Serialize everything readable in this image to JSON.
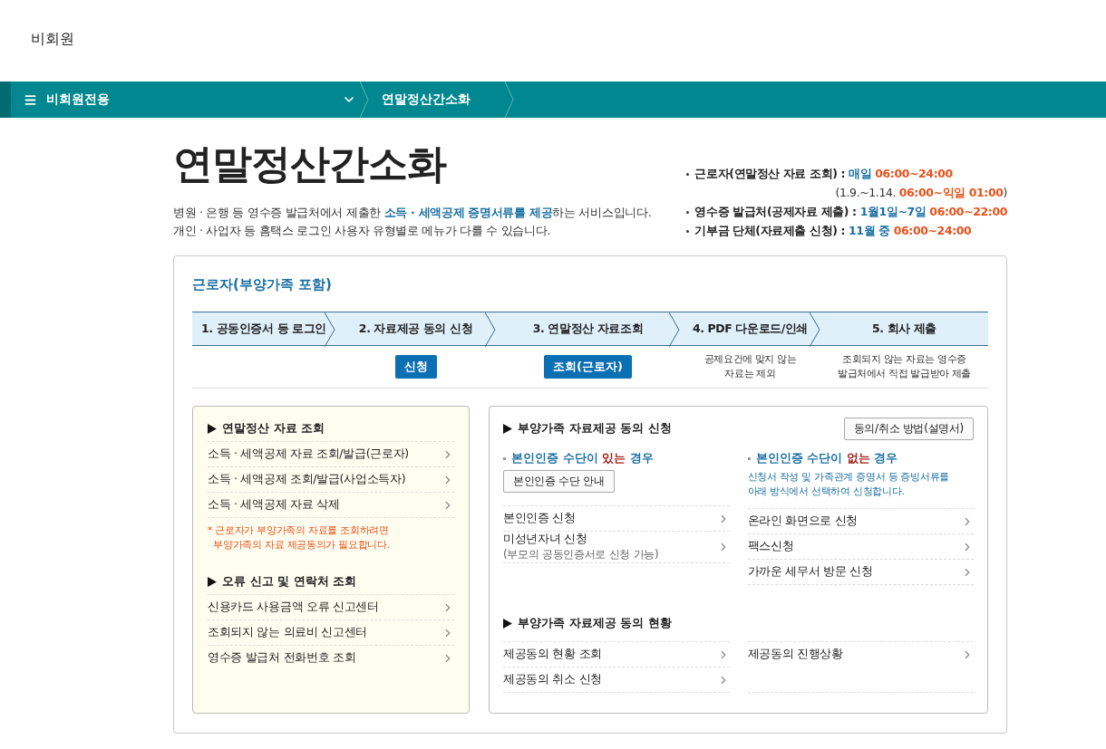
{
  "header": {
    "user_label": "비회원"
  },
  "nav": {
    "items": [
      {
        "label": "비회원전용",
        "kind": "dropdown"
      },
      {
        "label": "연말정산간소화",
        "kind": "page"
      }
    ]
  },
  "intro": {
    "title": "연말정산간소화",
    "description": [
      [
        {
          "text": "병원 · 은행 등 영수증 발급처에서 제출한 ",
          "color": "#333333",
          "bold": false
        },
        {
          "text": "소득 · 세액공제 증명서류를 제공",
          "color": "#1a6fa3",
          "bold": true
        },
        {
          "text": "하는 서비스입니다.",
          "color": "#333333",
          "bold": false
        }
      ],
      [
        {
          "text": "개인 · 사업자 등 홈택스 로그인 사용자 유형별로 메뉴가 다를 수 있습니다.",
          "color": "#333333",
          "bold": false
        }
      ]
    ],
    "schedule": [
      {
        "bullet": true,
        "segments": [
          {
            "text": "근로자(연말정산 자료 조회) : ",
            "color": "#222222",
            "bold": true
          },
          {
            "text": "매일 ",
            "color": "#1a6fa3",
            "bold": true
          },
          {
            "text": "06:00~24:00",
            "color": "#e8521a",
            "bold": true
          }
        ]
      },
      {
        "bullet": false,
        "segments": [
          {
            "text": "(1.9.~1.14. ",
            "color": "#333333",
            "bold": false
          },
          {
            "text": "06:00~익일 01:00",
            "color": "#e8521a",
            "bold": true
          },
          {
            "text": ")",
            "color": "#333333",
            "bold": false
          }
        ]
      },
      {
        "bullet": true,
        "segments": [
          {
            "text": "영수증 발급처(공제자료 제출) : ",
            "color": "#222222",
            "bold": true
          },
          {
            "text": "1월1일~7일 ",
            "color": "#1a6fa3",
            "bold": true
          },
          {
            "text": "06:00~22:00",
            "color": "#e8521a",
            "bold": true
          }
        ]
      },
      {
        "bullet": true,
        "segments": [
          {
            "text": "기부금 단체(자료제출 신청) : ",
            "color": "#222222",
            "bold": true
          },
          {
            "text": "11월 중 ",
            "color": "#1a6fa3",
            "bold": true
          },
          {
            "text": "06:00~24:00",
            "color": "#e8521a",
            "bold": true
          }
        ]
      }
    ]
  },
  "card": {
    "title": "근로자(부양가족 포함)",
    "steps": [
      {
        "label": "1. 공동인증서 등 로그인"
      },
      {
        "label": "2. 자료제공 동의 신청",
        "action": "신청"
      },
      {
        "label": "3. 연말정산 자료조회",
        "action": "조회(근로자)"
      },
      {
        "label": "4. PDF 다운로드/인쇄",
        "note": "공제요건에 맞지 않는\n자료는 제외"
      },
      {
        "label": "5. 회사 제출",
        "note": "조회되지 않는 자료는 영수증\n발급처에서 직접 발급받아 제출"
      }
    ],
    "left_panel": {
      "groups": [
        {
          "title": "연말정산 자료 조회",
          "links": [
            "소득 · 세액공제 자료 조회/발급(근로자)",
            "소득 · 세액공제 조회/발급(사업소득자)",
            "소득 · 세액공제 자료 삭제"
          ],
          "note": "* 근로자가 부양가족의 자료를 조회하려면\n  부양가족의 자료 제공동의가 필요합니다."
        },
        {
          "title": "오류 신고 및 연락처 조회",
          "links": [
            "신용카드 사용금액 오류 신고센터",
            "조회되지 않는 의료비 신고센터",
            "영수증 발급처 전화번호 조회"
          ]
        }
      ]
    },
    "right_panel": {
      "consent": {
        "title": "부양가족 자료제공 동의 신청",
        "guide_button": "동의/취소 방법(설명서)",
        "columns": [
          {
            "heading": [
              {
                "text": "본인인증 수단이 ",
                "color": "#1a6fa3",
                "bold": true
              },
              {
                "text": "있는",
                "color": "#a3201b",
                "bold": true
              },
              {
                "text": " 경우",
                "color": "#1a6fa3",
                "bold": true
              }
            ],
            "button": "본인인증 수단 안내",
            "links": [
              {
                "label": "본인인증 신청"
              },
              {
                "label": "미성년자녀 신청",
                "sub": "(부모의 공동인증서로 신청 가능)"
              }
            ]
          },
          {
            "heading": [
              {
                "text": "본인인증 수단이 ",
                "color": "#1a6fa3",
                "bold": true
              },
              {
                "text": "없는",
                "color": "#a3201b",
                "bold": true
              },
              {
                "text": " 경우",
                "color": "#1a6fa3",
                "bold": true
              }
            ],
            "description": "신청서 작성 및 가족관계 증명서 등 증빙서류를\n아래 방식에서 선택하여 신청합니다.",
            "links": [
              {
                "label": "온라인 화면으로 신청"
              },
              {
                "label": "팩스신청"
              },
              {
                "label": "가까운 세무서 방문 신청"
              }
            ]
          }
        ]
      },
      "status": {
        "title": "부양가족 자료제공 동의 현황",
        "columns": [
          [
            "제공동의 현황 조회",
            "제공동의 취소 신청"
          ],
          [
            "제공동의 진행상황"
          ]
        ]
      }
    }
  }
}
